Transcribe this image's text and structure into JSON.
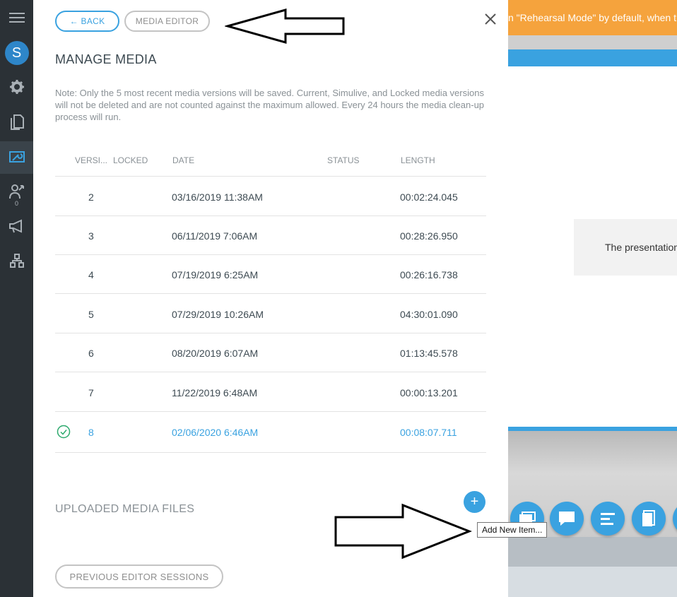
{
  "nav": {
    "avatar_letter": "S",
    "notification_count": "0"
  },
  "panel": {
    "back_label": "← BACK",
    "editor_label": "MEDIA EDITOR",
    "title": "MANAGE MEDIA",
    "note": "Note: Only the 5 most recent media versions will be saved. Current, Simulive, and Locked media versions will not be deleted and are not counted against the maximum allowed. Every 24 hours the media clean-up process will run.",
    "columns": [
      "VERSI...",
      "LOCKED",
      "DATE",
      "STATUS",
      "LENGTH"
    ],
    "rows": [
      {
        "version": "2",
        "date": "03/16/2019 11:38AM",
        "length": "00:02:24.045"
      },
      {
        "version": "3",
        "date": "06/11/2019 7:06AM",
        "length": "00:28:26.950"
      },
      {
        "version": "4",
        "date": "07/19/2019 6:25AM",
        "length": "00:26:16.738"
      },
      {
        "version": "5",
        "date": "07/29/2019 10:26AM",
        "length": "04:30:01.090"
      },
      {
        "version": "6",
        "date": "08/20/2019 6:07AM",
        "length": "01:13:45.578"
      },
      {
        "version": "7",
        "date": "11/22/2019 6:48AM",
        "length": "00:00:13.201"
      },
      {
        "version": "8",
        "date": "02/06/2020 6:46AM",
        "length": "00:08:07.711",
        "current": true
      }
    ],
    "uploaded_title": "UPLOADED MEDIA FILES",
    "add_label": "+",
    "tooltip": "Add New Item...",
    "previous_sessions_label": "PREVIOUS EDITOR SESSIONS"
  },
  "background": {
    "banner_text": "n \"Rehearsal Mode\" by default, when th",
    "slide_text": "The presentation"
  },
  "colors": {
    "accent": "#3aa2e0",
    "banner": "#f5a33d",
    "rail": "#2b3136"
  }
}
